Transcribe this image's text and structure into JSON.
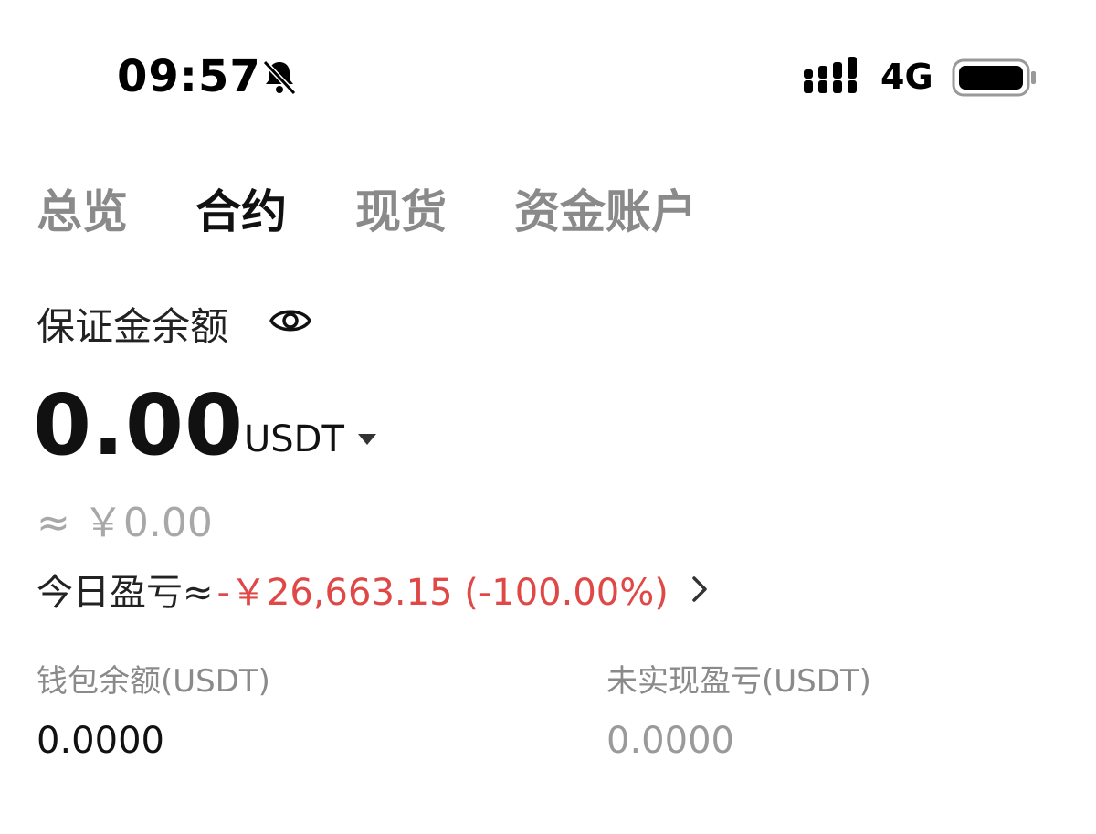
{
  "status_bar": {
    "time": "09:57",
    "network": "4G"
  },
  "tabs": [
    {
      "label": "总览",
      "active": false
    },
    {
      "label": "合约",
      "active": true
    },
    {
      "label": "现货",
      "active": false
    },
    {
      "label": "资金账户",
      "active": false
    }
  ],
  "margin": {
    "label": "保证金余额",
    "value": "0.00",
    "currency": "USDT",
    "approx": "≈ ￥0.00"
  },
  "pnl_today": {
    "label": "今日盈亏≈",
    "value": "-￥26,663.15 (-100.00%)"
  },
  "stats": {
    "wallet_label": "钱包余额(USDT)",
    "wallet_value": "0.0000",
    "unrealized_label": "未实现盈亏(USDT)",
    "unrealized_value": "0.0000"
  },
  "colors": {
    "loss": "#e04848",
    "muted": "#8a8a8a",
    "primary_text": "#111111"
  },
  "icons": {
    "mute": "bell-slash-icon",
    "signal": "signal-icon",
    "battery": "battery-icon",
    "visibility": "eye-icon",
    "dropdown": "caret-down-icon",
    "details": "chevron-right-icon"
  }
}
